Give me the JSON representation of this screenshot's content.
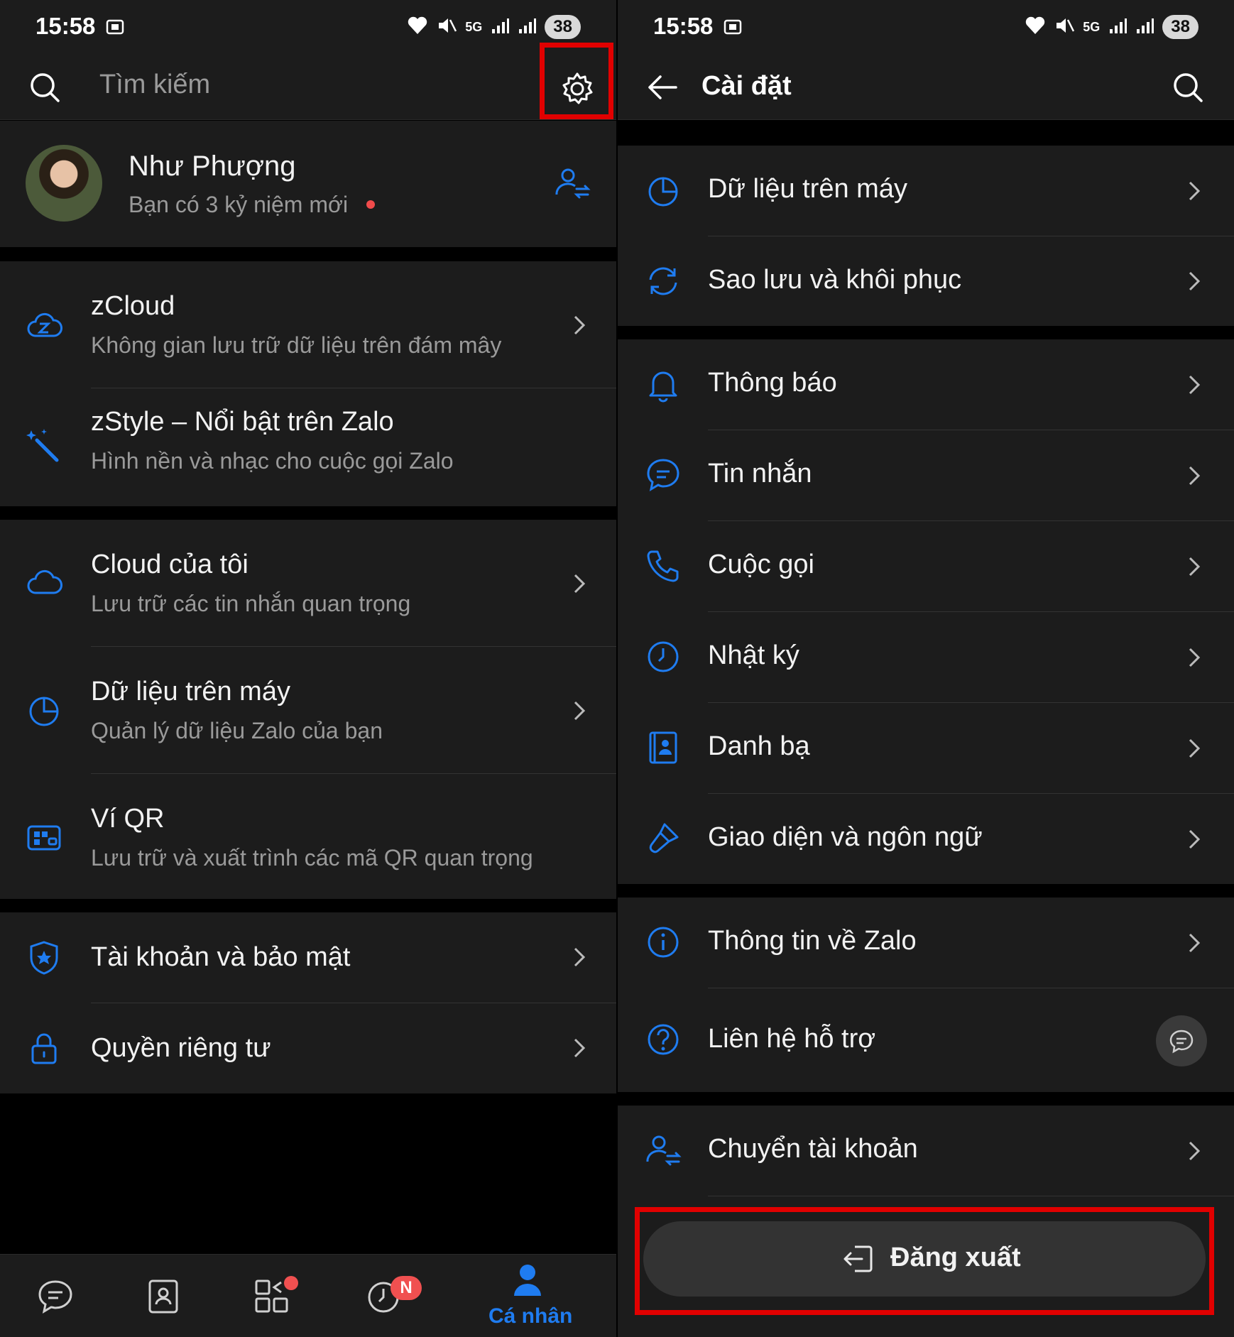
{
  "status": {
    "time": "15:58",
    "battery": "38",
    "network": "5G"
  },
  "left": {
    "search_placeholder": "Tìm kiếm",
    "profile": {
      "name": "Như Phượng",
      "subtitle": "Bạn có 3 kỷ niệm mới"
    },
    "items": [
      {
        "title": "zCloud",
        "subtitle": "Không gian lưu trữ dữ liệu trên đám mây",
        "icon": "zcloud-icon"
      },
      {
        "title": "zStyle – Nổi bật trên Zalo",
        "subtitle": "Hình nền và nhạc cho cuộc gọi Zalo",
        "icon": "magic-wand-icon"
      },
      {
        "title": "Cloud của tôi",
        "subtitle": "Lưu trữ các tin nhắn quan trọng",
        "icon": "cloud-icon"
      },
      {
        "title": "Dữ liệu trên máy",
        "subtitle": "Quản lý dữ liệu Zalo của bạn",
        "icon": "pie-chart-icon"
      },
      {
        "title": "Ví QR",
        "subtitle": "Lưu trữ và xuất trình các mã QR quan trọng",
        "icon": "qr-wallet-icon"
      },
      {
        "title": "Tài khoản và bảo mật",
        "icon": "shield-icon"
      },
      {
        "title": "Quyền riêng tư",
        "icon": "lock-icon"
      }
    ],
    "nav": {
      "active_label": "Cá nhân",
      "timeline_badge": "N"
    }
  },
  "right": {
    "header_title": "Cài đặt",
    "items": [
      {
        "title": "Dữ liệu trên máy",
        "icon": "pie-chart-icon"
      },
      {
        "title": "Sao lưu và khôi phục",
        "icon": "sync-icon"
      },
      {
        "title": "Thông báo",
        "icon": "bell-icon"
      },
      {
        "title": "Tin nhắn",
        "icon": "message-icon"
      },
      {
        "title": "Cuộc gọi",
        "icon": "phone-icon"
      },
      {
        "title": "Nhật ký",
        "icon": "clock-icon"
      },
      {
        "title": "Danh bạ",
        "icon": "contacts-icon"
      },
      {
        "title": "Giao diện và ngôn ngữ",
        "icon": "paintbrush-icon"
      },
      {
        "title": "Thông tin về Zalo",
        "icon": "info-icon"
      },
      {
        "title": "Liên hệ hỗ trợ",
        "icon": "help-icon"
      },
      {
        "title": "Chuyển tài khoản",
        "icon": "switch-account-icon"
      }
    ],
    "logout_label": "Đăng xuất"
  },
  "colors": {
    "accent": "#1f7cf0",
    "highlight": "#e10000",
    "background": "#1c1c1c"
  }
}
